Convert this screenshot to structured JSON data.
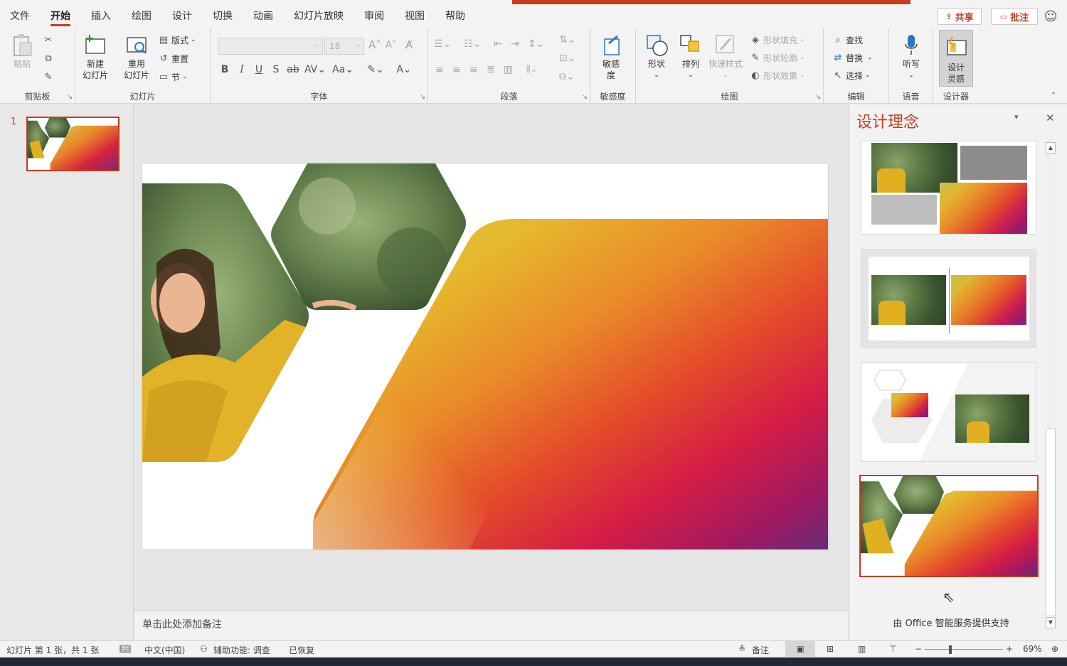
{
  "tabs": [
    "文件",
    "开始",
    "插入",
    "绘图",
    "设计",
    "切换",
    "动画",
    "幻灯片放映",
    "审阅",
    "视图",
    "帮助"
  ],
  "active_tab": "开始",
  "header": {
    "share": "共享",
    "comments": "批注"
  },
  "ribbon": {
    "clipboard": {
      "label": "剪贴板",
      "paste": "粘贴"
    },
    "slides": {
      "label": "幻灯片",
      "new_slide_1": "新建",
      "new_slide_2": "幻灯片",
      "reuse_1": "重用",
      "reuse_2": "幻灯片",
      "layout": "版式",
      "reset": "重置",
      "section": "节"
    },
    "font": {
      "label": "字体",
      "size": "18"
    },
    "paragraph": {
      "label": "段落"
    },
    "sensitivity": {
      "label": "敏感度",
      "btn_1": "敏感",
      "btn_2": "度"
    },
    "drawing": {
      "label": "绘图",
      "shapes": "形状",
      "arrange": "排列",
      "quick_styles": "快速样式",
      "fill": "形状填充",
      "outline": "形状轮廓",
      "effects": "形状效果"
    },
    "editing": {
      "label": "编辑",
      "find": "查找",
      "replace": "替换",
      "select": "选择"
    },
    "voice": {
      "label": "语音",
      "dictate": "听写"
    },
    "designer": {
      "label": "设计器",
      "btn_1": "设计",
      "btn_2": "灵感"
    }
  },
  "thumbnails": {
    "slide_number": "1"
  },
  "notes": {
    "placeholder": "单击此处添加备注"
  },
  "design_pane": {
    "title": "设计理念",
    "powered_by": "由 Office 智能服务提供支持"
  },
  "status": {
    "slide_info": "幻灯片 第 1 张，共 1 张",
    "language": "中文(中国)",
    "accessibility": "辅助功能: 调查",
    "recovered": "已恢复",
    "notes": "备注",
    "zoom": "69%"
  },
  "colors": {
    "accent": "#c43e1c"
  }
}
